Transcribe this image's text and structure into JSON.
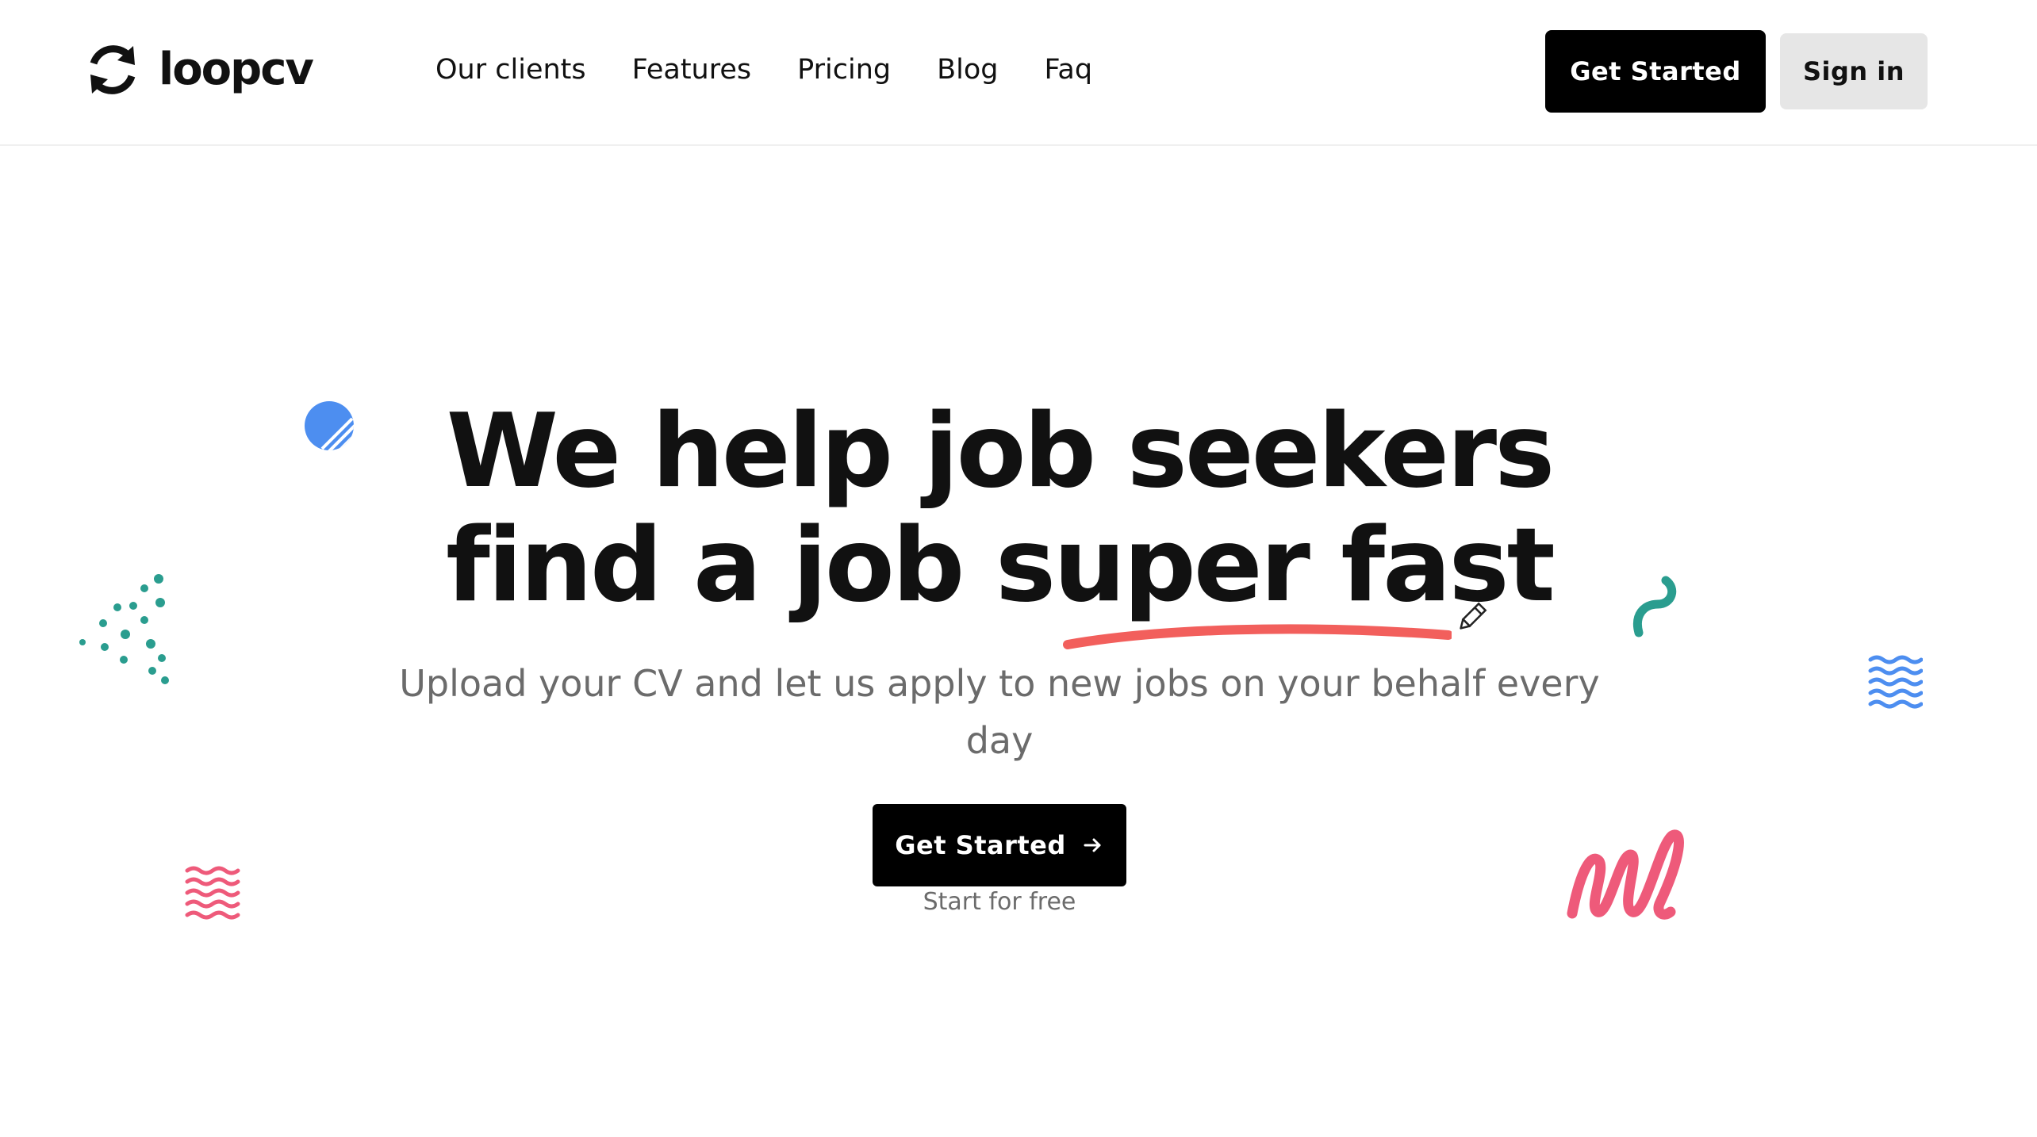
{
  "brand": {
    "name": "loopcv",
    "logo_icon": "loop-arrows-icon"
  },
  "nav": {
    "items": [
      {
        "label": "Our clients"
      },
      {
        "label": "Features"
      },
      {
        "label": "Pricing"
      },
      {
        "label": "Blog"
      },
      {
        "label": "Faq"
      }
    ]
  },
  "header": {
    "cta_label": "Get Started",
    "signin_label": "Sign in"
  },
  "hero": {
    "title_line1": "We help job seekers",
    "title_line2": "find a job super fast",
    "subtitle": "Upload your CV and let us apply to new jobs on your behalf every day",
    "cta_label": "Get Started",
    "cta_icon": "arrow-right-icon",
    "note": "Start for free"
  },
  "colors": {
    "text": "#111111",
    "muted": "#6b6b6b",
    "button_dark": "#000000",
    "button_light": "#e6e6e6",
    "accent_red": "#f25f5c",
    "accent_pink": "#ee5a7a",
    "accent_teal": "#2a9d8f",
    "accent_blue": "#4d8ef0"
  },
  "decorations": [
    "striped-circle-icon",
    "dot-cluster-icon",
    "wave-lines-icon",
    "squiggle-icon",
    "zigzag-scribble-icon",
    "pencil-icon"
  ]
}
